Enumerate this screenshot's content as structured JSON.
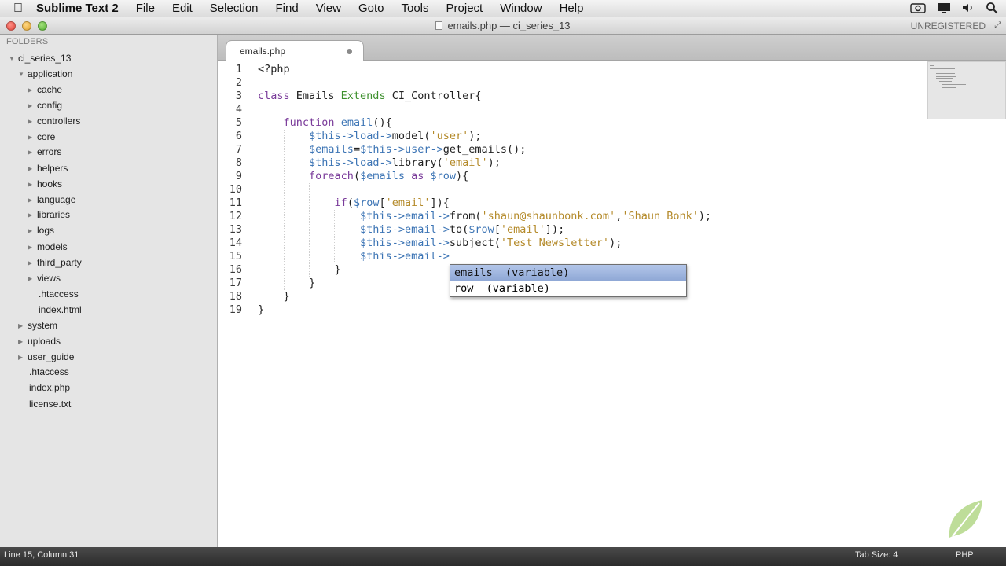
{
  "menubar": {
    "app_name": "Sublime Text 2",
    "items": [
      "File",
      "Edit",
      "Selection",
      "Find",
      "View",
      "Goto",
      "Tools",
      "Project",
      "Window",
      "Help"
    ],
    "icons": [
      "camera-icon",
      "display-icon",
      "volume-icon",
      "search-icon"
    ]
  },
  "window": {
    "title": "emails.php — ci_series_13",
    "unregistered": "UNREGISTERED"
  },
  "sidebar": {
    "heading": "FOLDERS",
    "items": [
      {
        "label": "ci_series_13",
        "type": "folder-open"
      },
      {
        "label": "application",
        "type": "folder-open"
      },
      {
        "label": "cache",
        "type": "folder"
      },
      {
        "label": "config",
        "type": "folder"
      },
      {
        "label": "controllers",
        "type": "folder"
      },
      {
        "label": "core",
        "type": "folder"
      },
      {
        "label": "errors",
        "type": "folder"
      },
      {
        "label": "helpers",
        "type": "folder"
      },
      {
        "label": "hooks",
        "type": "folder"
      },
      {
        "label": "language",
        "type": "folder"
      },
      {
        "label": "libraries",
        "type": "folder"
      },
      {
        "label": "logs",
        "type": "folder"
      },
      {
        "label": "models",
        "type": "folder"
      },
      {
        "label": "third_party",
        "type": "folder"
      },
      {
        "label": "views",
        "type": "folder"
      },
      {
        "label": ".htaccess",
        "type": "file"
      },
      {
        "label": "index.html",
        "type": "file"
      },
      {
        "label": "system",
        "type": "folder"
      },
      {
        "label": "uploads",
        "type": "folder"
      },
      {
        "label": "user_guide",
        "type": "folder"
      },
      {
        "label": ".htaccess",
        "type": "file"
      },
      {
        "label": "index.php",
        "type": "file"
      },
      {
        "label": "license.txt",
        "type": "file"
      }
    ]
  },
  "tab": {
    "title": "emails.php"
  },
  "editor": {
    "line_numbers": [
      "1",
      "2",
      "3",
      "4",
      "5",
      "6",
      "7",
      "8",
      "9",
      "10",
      "11",
      "12",
      "13",
      "14",
      "15",
      "16",
      "17",
      "18",
      "19"
    ],
    "lines": [
      {
        "text": "<?php"
      },
      {
        "text": ""
      },
      {
        "text": "class Emails Extends CI_Controller{"
      },
      {
        "text": ""
      },
      {
        "text": "    function email(){"
      },
      {
        "text": "        $this->load->model('user');"
      },
      {
        "text": "        $emails=$this->user->get_emails();"
      },
      {
        "text": "        $this->load->library('email');"
      },
      {
        "text": "        foreach($emails as $row){"
      },
      {
        "text": ""
      },
      {
        "text": "            if($row['email']){"
      },
      {
        "text": "                $this->email->from('shaun@shaunbonk.com','Shaun Bonk');"
      },
      {
        "text": "                $this->email->to($row['email']);"
      },
      {
        "text": "                $this->email->subject('Test Newsletter');"
      },
      {
        "text": "                $this->email->"
      },
      {
        "text": "            }"
      },
      {
        "text": "        }"
      },
      {
        "text": "    }"
      },
      {
        "text": "}"
      }
    ]
  },
  "autocomplete": {
    "items": [
      {
        "label": "emails  (variable)",
        "selected": true
      },
      {
        "label": "row  (variable)",
        "selected": false
      }
    ]
  },
  "statusbar": {
    "position": "Line 15, Column 31",
    "tab_size": "Tab Size: 4",
    "syntax": "PHP"
  },
  "colors": {
    "variable": "#3d75b5",
    "string": "#b48a2a",
    "keyword": "#7a3b9a",
    "class": "#3c8f2c",
    "selection": "#a9bde3"
  }
}
